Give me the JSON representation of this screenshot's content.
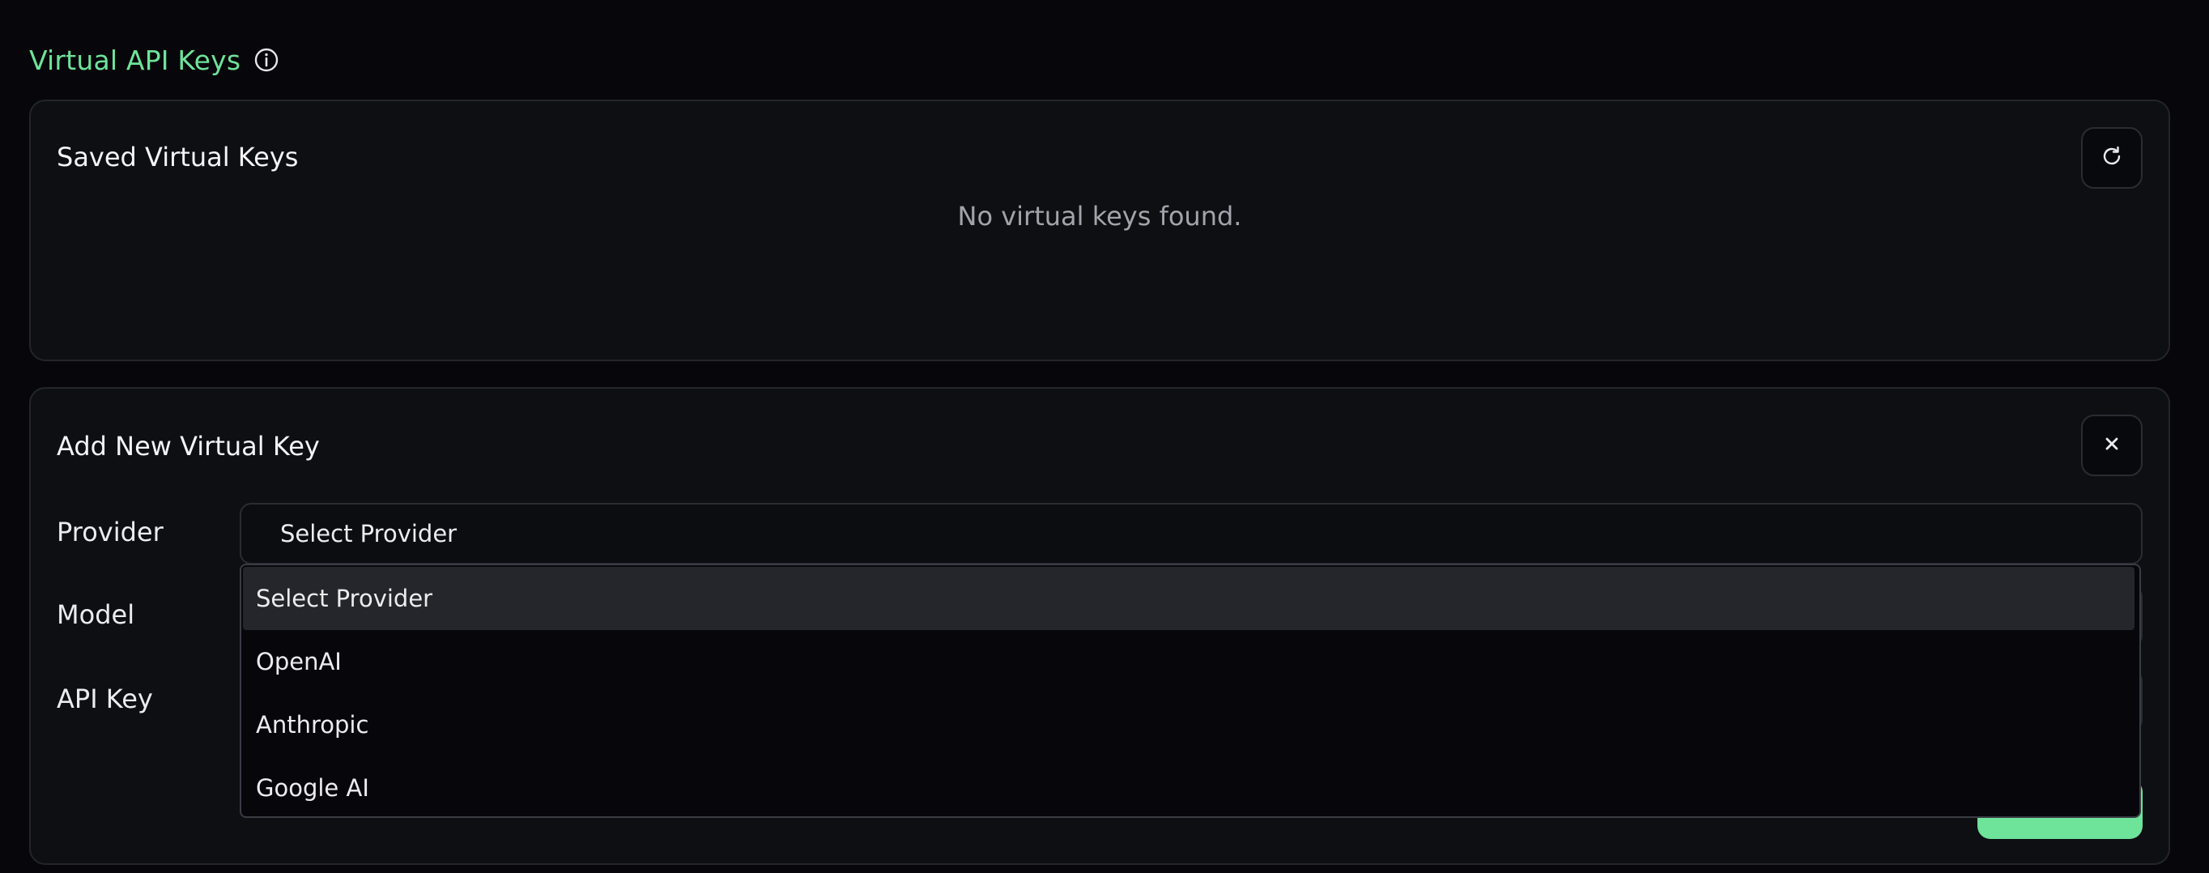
{
  "page": {
    "title": "Virtual API Keys",
    "info_icon": "info-icon"
  },
  "saved_keys": {
    "title": "Saved Virtual Keys",
    "refresh_icon": "refresh-icon",
    "empty_message": "No virtual keys found."
  },
  "add_key": {
    "title": "Add New Virtual Key",
    "close_icon": "close-icon",
    "provider_label": "Provider",
    "model_label": "Model",
    "api_key_label": "API Key",
    "provider_selected": "Select Provider"
  },
  "provider_dropdown": {
    "options": [
      "Select Provider",
      "OpenAI",
      "Anthropic",
      "Google AI"
    ],
    "selected_index": 0
  },
  "colors": {
    "accent": "#6ee39a",
    "background": "#07070b",
    "card": "#0e0f13"
  }
}
